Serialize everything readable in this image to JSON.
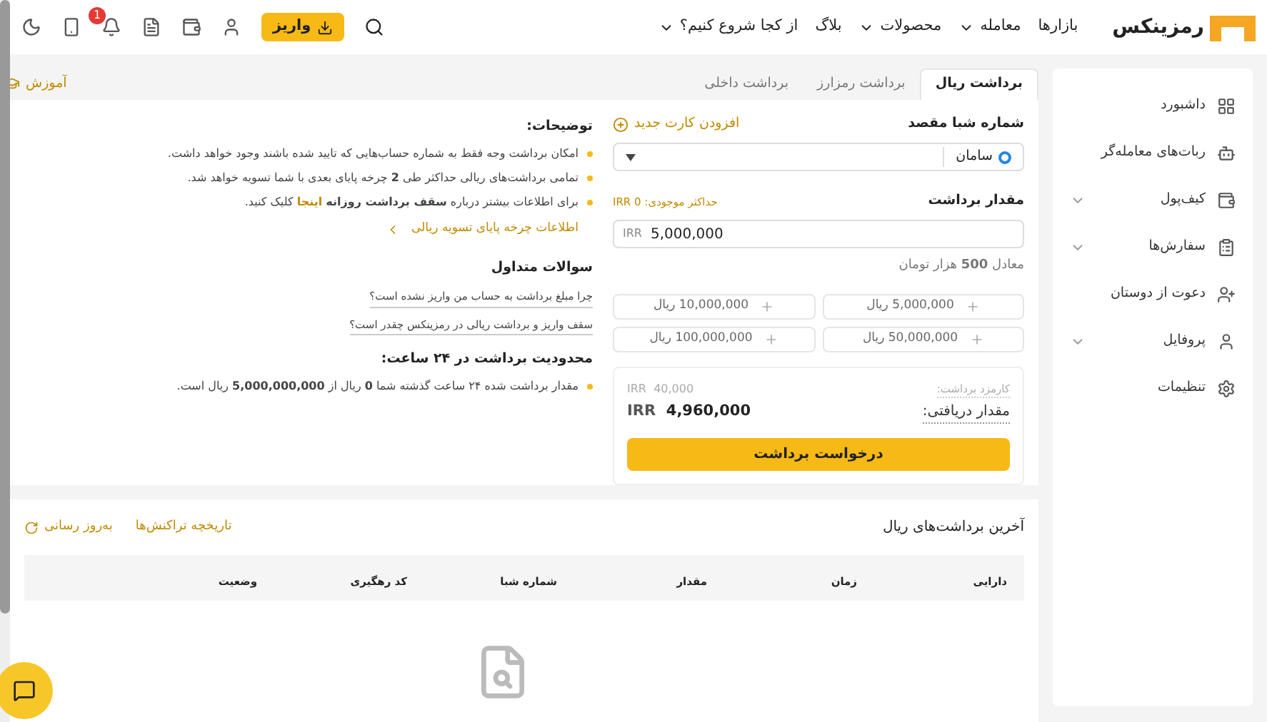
{
  "header": {
    "logo_text": "رمزینکس",
    "nav": [
      {
        "label": "بازارها",
        "dropdown": false
      },
      {
        "label": "معامله",
        "dropdown": true
      },
      {
        "label": "محصولات",
        "dropdown": true
      },
      {
        "label": "بلاگ",
        "dropdown": false
      },
      {
        "label": "از کجا شروع کنیم؟",
        "dropdown": true
      }
    ],
    "deposit_button": "واریز",
    "notification_count": "1"
  },
  "sidebar": {
    "items": [
      {
        "label": "داشبورد",
        "kind": "dashboard",
        "expandable": false
      },
      {
        "label": "ربات‌های معامله‌گر",
        "kind": "bot",
        "expandable": false
      },
      {
        "label": "کیف‌پول",
        "kind": "wallet",
        "expandable": true
      },
      {
        "label": "سفارش‌ها",
        "kind": "orders",
        "expandable": true
      },
      {
        "label": "دعوت از دوستان",
        "kind": "invite",
        "expandable": false
      },
      {
        "label": "پروفایل",
        "kind": "profile",
        "expandable": true
      },
      {
        "label": "تنظیمات",
        "kind": "settings",
        "expandable": false
      }
    ]
  },
  "tabs": [
    {
      "label": "برداشت ریال",
      "selected": true
    },
    {
      "label": "برداشت رمزارز",
      "selected": false
    },
    {
      "label": "برداشت داخلی",
      "selected": false
    }
  ],
  "tutorial_link": "آموزش",
  "form": {
    "iban_label": "شماره شبا مقصد",
    "add_card": "افزودن کارت جدید",
    "bank": "سامان",
    "amount_label": "مقدار برداشت",
    "max_balance": "حداکثر موجودی: IRR 0",
    "currency": "IRR",
    "amount": "5,000,000",
    "equivalent": "معادل **500** هزار تومان",
    "quick_amounts": [
      "5,000,000 ریال",
      "10,000,000 ریال",
      "50,000,000 ریال",
      "100,000,000 ریال"
    ],
    "fee_label": "کارمزد برداشت:",
    "fee_currency": "IRR",
    "fee": "40,000",
    "received_label": "مقدار دریافتی:",
    "received_currency": "IRR",
    "received": "4,960,000",
    "submit": "درخواست برداشت"
  },
  "info": {
    "title": "توضیحات:",
    "bullets": [
      "امکان برداشت وجه فقط به شماره حساب‌هایی که تایید شده باشند وجود خواهد داشت.",
      "تمامی برداشت‌های ریالی حداکثر طی **2** چرخه پایای بعدی با شما تسویه خواهد شد."
    ],
    "more": {
      "before": "برای اطلاعات بیشتر درباره **سقف برداشت روزانه**",
      "link": "اینجا",
      "after": "کلیک کنید."
    },
    "paya_link": "اطلاعات چرخه پایای تسویه ریالی",
    "faq_title": "سوالات متداول",
    "faq": [
      "چرا مبلغ برداشت به حساب من واریز نشده است؟",
      "سقف واریز و برداشت ریالی در رمزینکس چقدر است؟"
    ],
    "limit_title": "محدودیت برداشت در ۲۴ ساعت:",
    "limit_text": "مقدار برداشت شده ۲۴ ساعت گذشته شما **0** ریال از **5,000,000,000** ریال است."
  },
  "history": {
    "title": "آخرین برداشت‌های ریال",
    "history_link": "تاریخچه تراکنش‌ها",
    "refresh": "به‌روز رسانی",
    "columns": [
      "دارایی",
      "زمان",
      "مقدار",
      "شماره شبا",
      "کد رهگیری",
      "وضعیت"
    ]
  }
}
